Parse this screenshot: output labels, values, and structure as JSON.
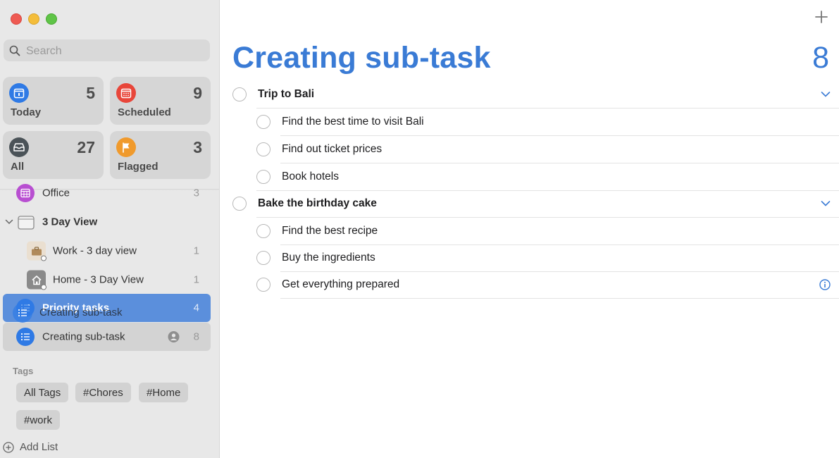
{
  "sidebar": {
    "search": {
      "placeholder": "Search",
      "value": ""
    },
    "smart_lists": [
      {
        "label": "Today",
        "count": "5",
        "icon": "calendar-today-icon",
        "color": "#2f7ae5"
      },
      {
        "label": "Scheduled",
        "count": "9",
        "icon": "calendar-scheduled-icon",
        "color": "#e8463a"
      },
      {
        "label": "All",
        "count": "27",
        "icon": "tray-icon",
        "color": "#4b5358"
      },
      {
        "label": "Flagged",
        "count": "3",
        "icon": "flag-icon",
        "color": "#f09a2c"
      }
    ],
    "lists": [
      {
        "label": "Office",
        "count": "3",
        "icon": "calendar-grid-icon"
      },
      {
        "label": "3 Day View",
        "count": "",
        "icon": "folder-icon"
      },
      {
        "label": "Work - 3 day view",
        "count": "1",
        "icon": "briefcase-icon"
      },
      {
        "label": "Home - 3 Day View",
        "count": "1",
        "icon": "house-icon"
      },
      {
        "label": "Priority tasks",
        "count": "4",
        "icon": "list-icon"
      },
      {
        "label": "Creating sub-task",
        "count": "8",
        "icon": "list-icon"
      }
    ],
    "drag_label": "Creating sub-task",
    "tags_header": "Tags",
    "tags": [
      "All Tags",
      "#Chores",
      "#Home",
      "#work"
    ],
    "add_list": "Add List"
  },
  "main": {
    "title": "Creating sub-task",
    "count": "8",
    "accent": "#3a7bd5",
    "groups": [
      {
        "title": "Trip to Bali",
        "subtasks": [
          "Find the best time to visit Bali",
          "Find out ticket prices",
          "Book hotels"
        ]
      },
      {
        "title": "Bake the birthday cake",
        "subtasks": [
          "Find the best recipe",
          "Buy the ingredients",
          "Get everything prepared"
        ]
      }
    ]
  }
}
